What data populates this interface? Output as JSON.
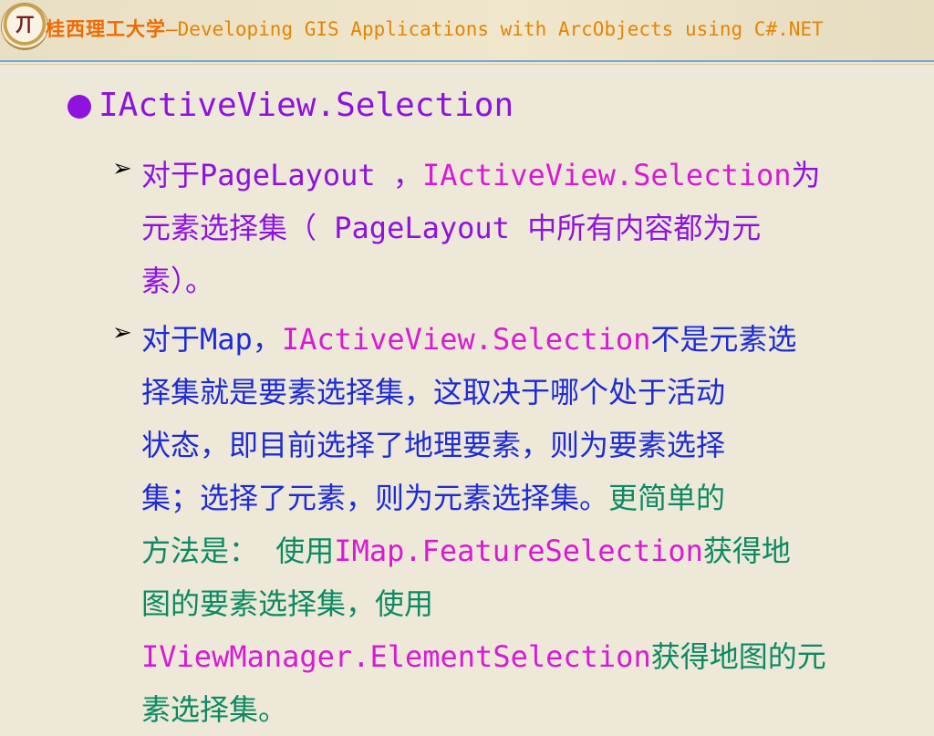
{
  "header": {
    "logo_label": "Institution seal",
    "title_cn": "桂西理工大学",
    "title_separator": "—",
    "title_en": "Developing GIS Applications with ArcObjects using C#.NET"
  },
  "content": {
    "heading": "IActiveView.Selection",
    "item1": {
      "bullet": "➢",
      "line1_part1": "对于PageLayout ，",
      "line1_part2": "IActiveView.Selection",
      "line1_part3": "为",
      "line2": "元素选择集（ PageLayout 中所有内容都为元",
      "line3": "素）。"
    },
    "item2": {
      "bullet": "➢",
      "line1_part1": "对于Map，",
      "line1_part2": "IActiveView.Selection",
      "line1_part3": "不是元素选",
      "line2": "择集就是要素选择集，这取决于哪个处于活动",
      "line3": "状态，即目前选择了地理要素，则为要素选择",
      "line4": "集；选择了元素，则为元素选择集。",
      "line4_green": "更简单的",
      "line5": "方法是：",
      "line5_gap": "  ",
      "line5_part2": "使用",
      "line5_code": "IMap.FeatureSelection",
      "line5_part3": "获得地",
      "line6": "图的要素选择集，使用",
      "line7_code": "IViewManager.ElementSelection",
      "line7_part2": "获得地图的元",
      "line8": "素选择集。"
    }
  },
  "colors": {
    "background": "#eee8d8",
    "header_orange": "#e87400",
    "heading_purple": "#8f12e0",
    "accent_pink": "#d81ad5",
    "body_blue": "#1d2bd8",
    "green": "#0b8a63"
  }
}
